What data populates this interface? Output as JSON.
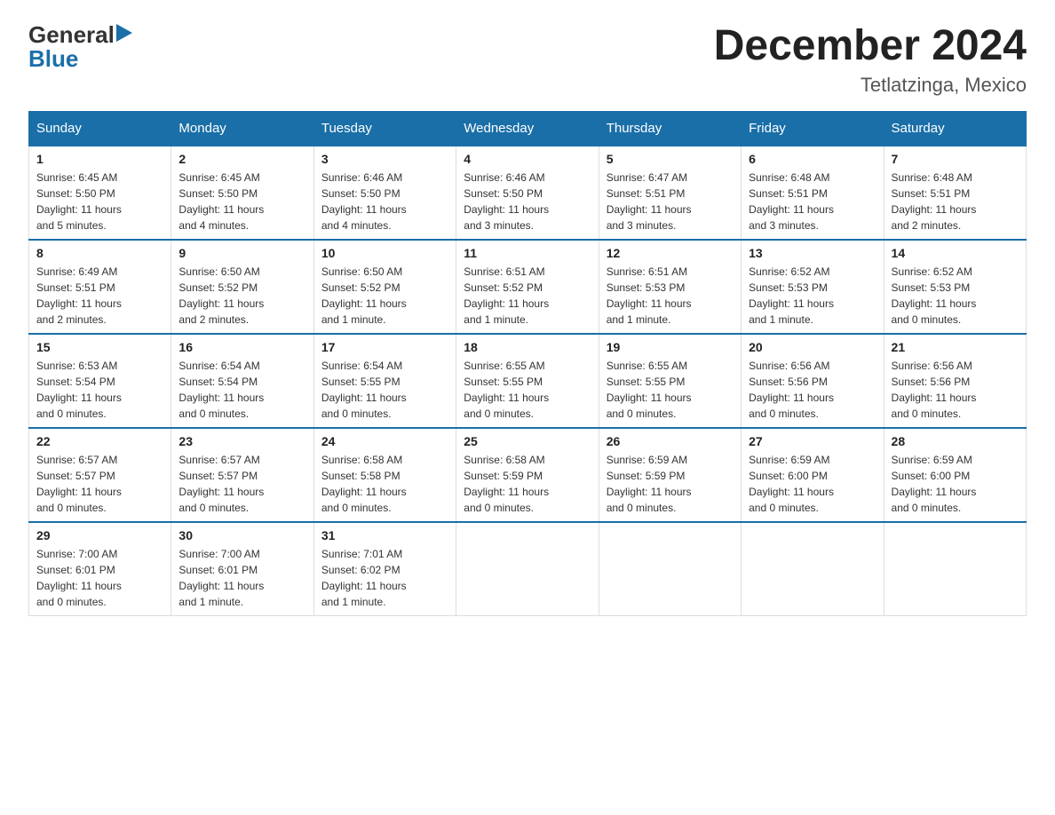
{
  "logo": {
    "text_general": "General",
    "text_blue": "Blue"
  },
  "header": {
    "title": "December 2024",
    "subtitle": "Tetlatzinga, Mexico"
  },
  "days_of_week": [
    "Sunday",
    "Monday",
    "Tuesday",
    "Wednesday",
    "Thursday",
    "Friday",
    "Saturday"
  ],
  "weeks": [
    [
      {
        "day": "1",
        "sunrise": "6:45 AM",
        "sunset": "5:50 PM",
        "daylight": "11 hours and 5 minutes."
      },
      {
        "day": "2",
        "sunrise": "6:45 AM",
        "sunset": "5:50 PM",
        "daylight": "11 hours and 4 minutes."
      },
      {
        "day": "3",
        "sunrise": "6:46 AM",
        "sunset": "5:50 PM",
        "daylight": "11 hours and 4 minutes."
      },
      {
        "day": "4",
        "sunrise": "6:46 AM",
        "sunset": "5:50 PM",
        "daylight": "11 hours and 3 minutes."
      },
      {
        "day": "5",
        "sunrise": "6:47 AM",
        "sunset": "5:51 PM",
        "daylight": "11 hours and 3 minutes."
      },
      {
        "day": "6",
        "sunrise": "6:48 AM",
        "sunset": "5:51 PM",
        "daylight": "11 hours and 3 minutes."
      },
      {
        "day": "7",
        "sunrise": "6:48 AM",
        "sunset": "5:51 PM",
        "daylight": "11 hours and 2 minutes."
      }
    ],
    [
      {
        "day": "8",
        "sunrise": "6:49 AM",
        "sunset": "5:51 PM",
        "daylight": "11 hours and 2 minutes."
      },
      {
        "day": "9",
        "sunrise": "6:50 AM",
        "sunset": "5:52 PM",
        "daylight": "11 hours and 2 minutes."
      },
      {
        "day": "10",
        "sunrise": "6:50 AM",
        "sunset": "5:52 PM",
        "daylight": "11 hours and 1 minute."
      },
      {
        "day": "11",
        "sunrise": "6:51 AM",
        "sunset": "5:52 PM",
        "daylight": "11 hours and 1 minute."
      },
      {
        "day": "12",
        "sunrise": "6:51 AM",
        "sunset": "5:53 PM",
        "daylight": "11 hours and 1 minute."
      },
      {
        "day": "13",
        "sunrise": "6:52 AM",
        "sunset": "5:53 PM",
        "daylight": "11 hours and 1 minute."
      },
      {
        "day": "14",
        "sunrise": "6:52 AM",
        "sunset": "5:53 PM",
        "daylight": "11 hours and 0 minutes."
      }
    ],
    [
      {
        "day": "15",
        "sunrise": "6:53 AM",
        "sunset": "5:54 PM",
        "daylight": "11 hours and 0 minutes."
      },
      {
        "day": "16",
        "sunrise": "6:54 AM",
        "sunset": "5:54 PM",
        "daylight": "11 hours and 0 minutes."
      },
      {
        "day": "17",
        "sunrise": "6:54 AM",
        "sunset": "5:55 PM",
        "daylight": "11 hours and 0 minutes."
      },
      {
        "day": "18",
        "sunrise": "6:55 AM",
        "sunset": "5:55 PM",
        "daylight": "11 hours and 0 minutes."
      },
      {
        "day": "19",
        "sunrise": "6:55 AM",
        "sunset": "5:55 PM",
        "daylight": "11 hours and 0 minutes."
      },
      {
        "day": "20",
        "sunrise": "6:56 AM",
        "sunset": "5:56 PM",
        "daylight": "11 hours and 0 minutes."
      },
      {
        "day": "21",
        "sunrise": "6:56 AM",
        "sunset": "5:56 PM",
        "daylight": "11 hours and 0 minutes."
      }
    ],
    [
      {
        "day": "22",
        "sunrise": "6:57 AM",
        "sunset": "5:57 PM",
        "daylight": "11 hours and 0 minutes."
      },
      {
        "day": "23",
        "sunrise": "6:57 AM",
        "sunset": "5:57 PM",
        "daylight": "11 hours and 0 minutes."
      },
      {
        "day": "24",
        "sunrise": "6:58 AM",
        "sunset": "5:58 PM",
        "daylight": "11 hours and 0 minutes."
      },
      {
        "day": "25",
        "sunrise": "6:58 AM",
        "sunset": "5:59 PM",
        "daylight": "11 hours and 0 minutes."
      },
      {
        "day": "26",
        "sunrise": "6:59 AM",
        "sunset": "5:59 PM",
        "daylight": "11 hours and 0 minutes."
      },
      {
        "day": "27",
        "sunrise": "6:59 AM",
        "sunset": "6:00 PM",
        "daylight": "11 hours and 0 minutes."
      },
      {
        "day": "28",
        "sunrise": "6:59 AM",
        "sunset": "6:00 PM",
        "daylight": "11 hours and 0 minutes."
      }
    ],
    [
      {
        "day": "29",
        "sunrise": "7:00 AM",
        "sunset": "6:01 PM",
        "daylight": "11 hours and 0 minutes."
      },
      {
        "day": "30",
        "sunrise": "7:00 AM",
        "sunset": "6:01 PM",
        "daylight": "11 hours and 1 minute."
      },
      {
        "day": "31",
        "sunrise": "7:01 AM",
        "sunset": "6:02 PM",
        "daylight": "11 hours and 1 minute."
      },
      null,
      null,
      null,
      null
    ]
  ],
  "labels": {
    "sunrise": "Sunrise:",
    "sunset": "Sunset:",
    "daylight": "Daylight:"
  }
}
